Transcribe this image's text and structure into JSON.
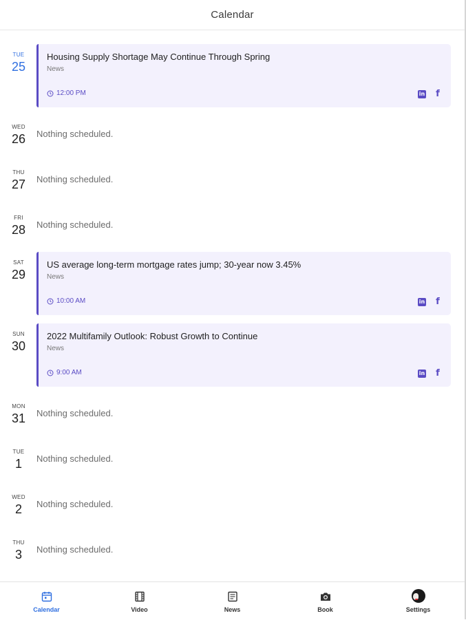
{
  "header": {
    "title": "Calendar"
  },
  "days": [
    {
      "dow": "TUE",
      "num": "25",
      "today": true,
      "event": {
        "title": "Housing Supply Shortage May Continue Through Spring",
        "category": "News",
        "time": "12:00 PM"
      }
    },
    {
      "dow": "WED",
      "num": "26",
      "empty_text": "Nothing scheduled."
    },
    {
      "dow": "THU",
      "num": "27",
      "empty_text": "Nothing scheduled."
    },
    {
      "dow": "FRI",
      "num": "28",
      "empty_text": "Nothing scheduled."
    },
    {
      "dow": "SAT",
      "num": "29",
      "event": {
        "title": "US average long-term mortgage rates jump; 30-year now 3.45%",
        "category": "News",
        "time": "10:00 AM"
      }
    },
    {
      "dow": "SUN",
      "num": "30",
      "event": {
        "title": "2022 Multifamily Outlook: Robust Growth to Continue",
        "category": "News",
        "time": "9:00 AM"
      }
    },
    {
      "dow": "MON",
      "num": "31",
      "empty_text": "Nothing scheduled."
    },
    {
      "dow": "TUE",
      "num": "1",
      "empty_text": "Nothing scheduled."
    },
    {
      "dow": "WED",
      "num": "2",
      "empty_text": "Nothing scheduled."
    },
    {
      "dow": "THU",
      "num": "3",
      "empty_text": "Nothing scheduled."
    }
  ],
  "social_icons": [
    "linkedin-icon",
    "facebook-icon"
  ],
  "bottom_nav": [
    {
      "label": "Calendar",
      "icon": "calendar-icon",
      "active": true
    },
    {
      "label": "Video",
      "icon": "film-icon"
    },
    {
      "label": "News",
      "icon": "newspaper-icon"
    },
    {
      "label": "Book",
      "icon": "camera-icon"
    },
    {
      "label": "Settings",
      "icon": "avatar-icon"
    }
  ],
  "colors": {
    "accent": "#5a4bc4",
    "card_bg": "#f3f1fd",
    "today": "#2f6fe0",
    "active_nav": "#2f6fe0"
  }
}
